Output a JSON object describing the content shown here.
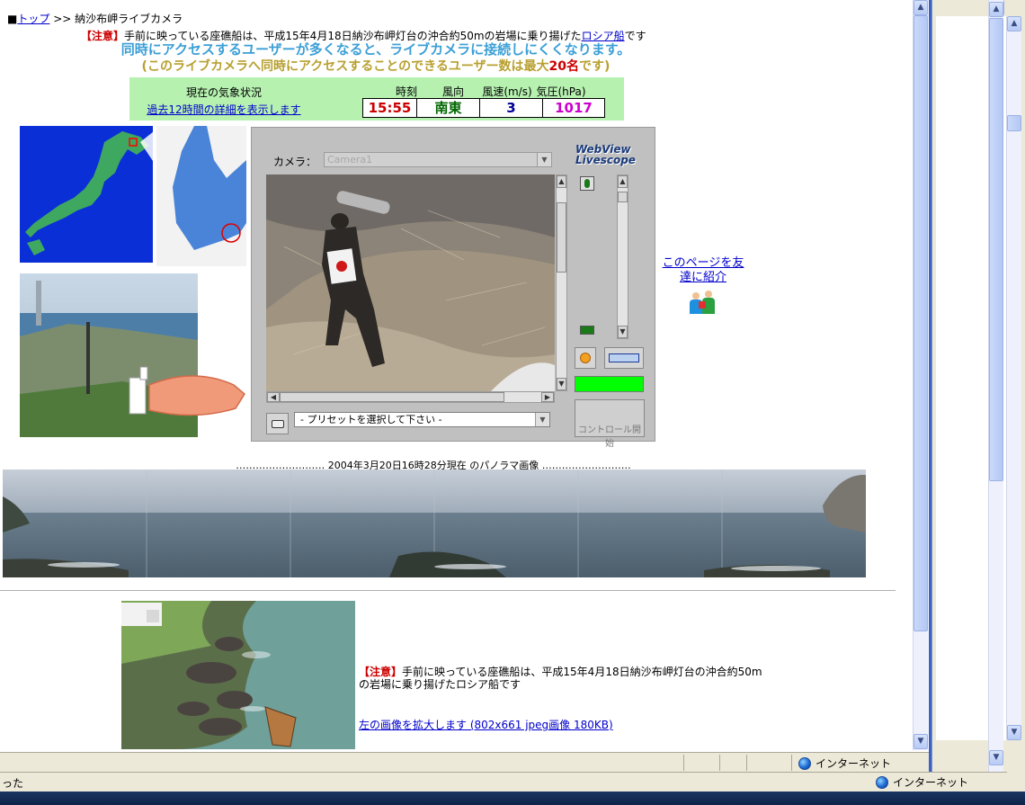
{
  "breadcrumb": {
    "marker": "■",
    "top_link": "トップ",
    "separator": ">>",
    "current": "納沙布岬ライブカメラ"
  },
  "notice_top": {
    "tag": "【注意】",
    "text": "手前に映っている座礁船は、平成15年4月18日納沙布岬灯台の沖合約50mの岩場に乗り揚げた",
    "link": "ロシア船",
    "suffix": "です"
  },
  "warning_access": "同時にアクセスするユーザーが多くなると、ライブカメラに接続しにくくなります。",
  "warning_limit": {
    "prefix": "(このライブカメラへ同時にアクセスすることのできるユーザー数は最大",
    "number": "20名",
    "suffix": "です)"
  },
  "weather": {
    "title": "現在の気象状況",
    "details_link": "過去12時間の詳細を表示します",
    "headers": [
      "時刻",
      "風向",
      "風速(m/s)",
      "気圧(hPa)"
    ],
    "values": [
      "15:55",
      "南東",
      "3",
      "1017"
    ],
    "value_colors": [
      "#cc0000",
      "#006600",
      "#000099",
      "#cc00cc"
    ]
  },
  "camera": {
    "label": "カメラ：",
    "select_value": "Camera1",
    "logo_line1": "WebView",
    "logo_line2": "Livescope",
    "preset_placeholder": "- プリセットを選択して下さい -",
    "control_button": "コントロール開始"
  },
  "share": {
    "link": "このページを友達に紹介"
  },
  "panorama": {
    "caption": "……………………… 2004年3月20日16時28分現在 のパノラマ画像 ………………………"
  },
  "notice_bottom": {
    "tag": "【注意】",
    "text": "手前に映っている座礁船は、平成15年4月18日納沙布岬灯台の沖合約50mの岩場に乗り揚げたロシア船です",
    "enlarge_link": "左の画像を拡大します (802x661 jpeg画像 180KB)"
  },
  "statusbar": {
    "zone": "インターネット",
    "back_zone": "インターネット",
    "back_left": "った"
  },
  "icons": [
    "globe-icon",
    "camera-icon",
    "friends-icon",
    "sun-icon",
    "scroll-arrow-icons"
  ]
}
